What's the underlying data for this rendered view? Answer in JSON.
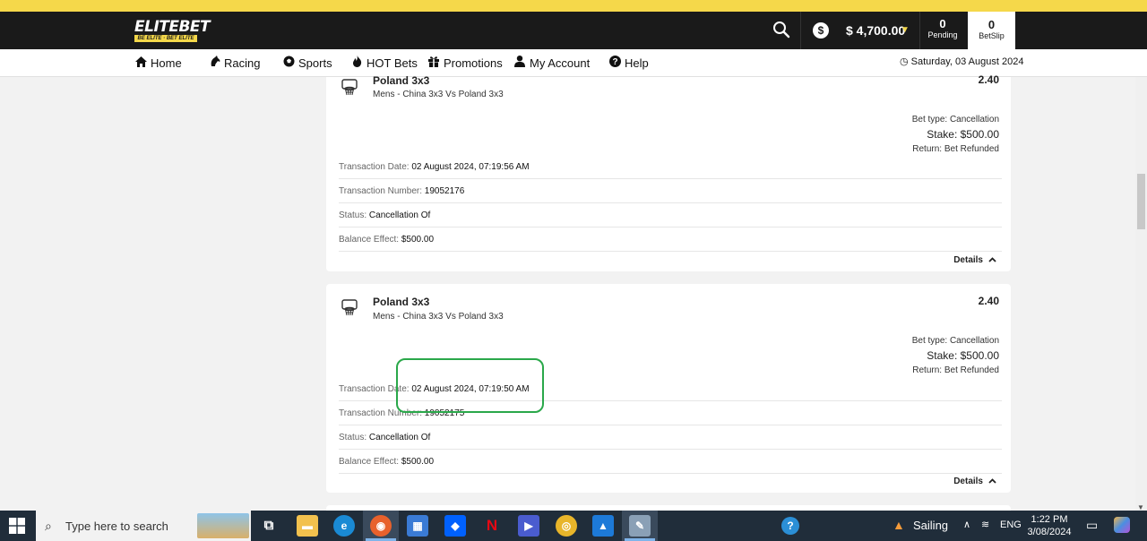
{
  "header": {
    "logo_main": "ELITEBET",
    "logo_tagline": "BE ELITE · BET ELITE",
    "balance": "$ 4,700.00",
    "pending_count": "0",
    "pending_label": "Pending",
    "betslip_count": "0",
    "betslip_label": "BetSlip",
    "accent_color": "#f5d84a"
  },
  "nav": {
    "items": [
      {
        "label": "Home",
        "icon": "home-icon"
      },
      {
        "label": "Racing",
        "icon": "horse-icon"
      },
      {
        "label": "Sports",
        "icon": "soccer-ball-icon"
      },
      {
        "label": "HOT Bets",
        "icon": "flame-icon"
      },
      {
        "label": "Promotions",
        "icon": "gift-icon"
      },
      {
        "label": "My Account",
        "icon": "user-icon"
      },
      {
        "label": "Help",
        "icon": "question-icon"
      }
    ],
    "date": "Saturday, 03 August 2024"
  },
  "transactions": [
    {
      "selection": "Poland 3x3",
      "event": "Mens - China 3x3 Vs Poland 3x3",
      "odds": "2.40",
      "bet_type": "Bet type: Cancellation",
      "stake": "Stake: $500.00",
      "return": "Return: Bet Refunded",
      "date_label": "Transaction Date:",
      "date_value": "02 August 2024, 07:19:56 AM",
      "number_label": "Transaction Number:",
      "number_value": "19052176",
      "status_label": "Status:",
      "status_value": "Cancellation Of",
      "balance_label": "Balance Effect:",
      "balance_value": "$500.00",
      "details_label": "Details"
    },
    {
      "selection": "Poland 3x3",
      "event": "Mens - China 3x3 Vs Poland 3x3",
      "odds": "2.40",
      "bet_type": "Bet type: Cancellation",
      "stake": "Stake: $500.00",
      "return": "Return: Bet Refunded",
      "date_label": "Transaction Date:",
      "date_value": "02 August 2024, 07:19:50 AM",
      "number_label": "Transaction Number:",
      "number_value": "19052175",
      "status_label": "Status:",
      "status_value": "Cancellation Of",
      "balance_label": "Balance Effect:",
      "balance_value": "$500.00",
      "details_label": "Details"
    }
  ],
  "taskbar": {
    "search_placeholder": "Type here to search",
    "weather": "Sailing",
    "language": "ENG",
    "time": "1:22 PM",
    "date": "3/08/2024"
  }
}
